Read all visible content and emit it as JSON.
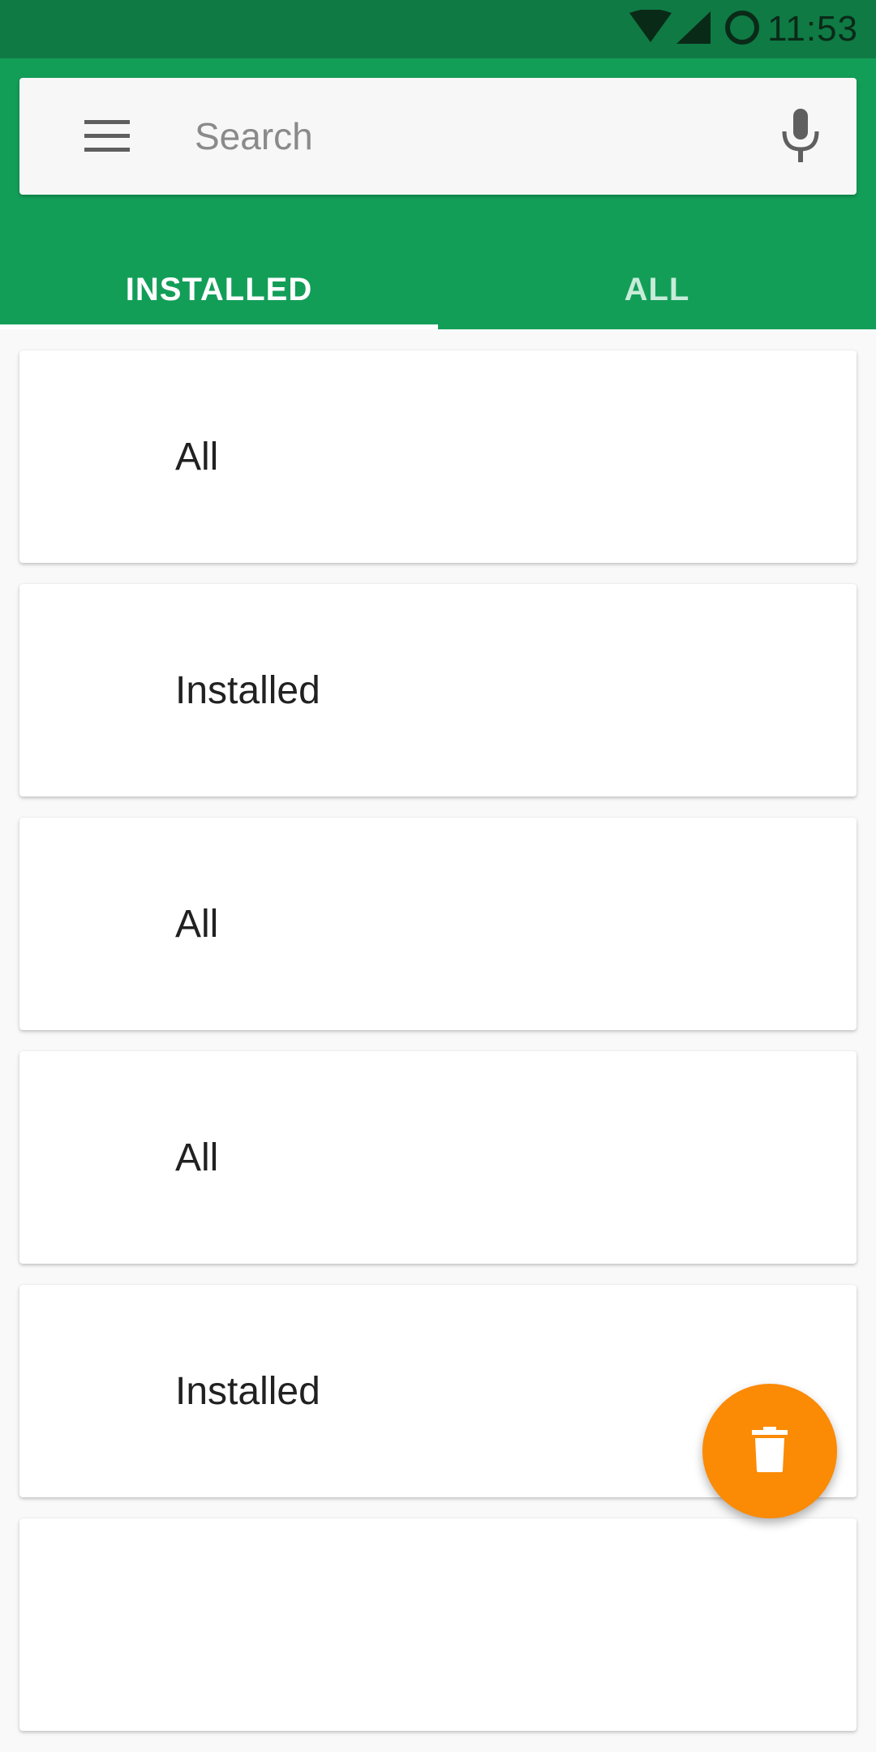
{
  "status_bar": {
    "time": "11:53",
    "icons": [
      "wifi-icon",
      "cell-signal-icon",
      "battery-ring-icon"
    ]
  },
  "search": {
    "placeholder": "Search",
    "menu_icon": "menu-icon",
    "mic_icon": "microphone-icon"
  },
  "tabs": [
    {
      "label": "INSTALLED",
      "selected": true
    },
    {
      "label": "ALL",
      "selected": false
    }
  ],
  "list": {
    "items": [
      {
        "label": "All"
      },
      {
        "label": "Installed"
      },
      {
        "label": "All"
      },
      {
        "label": "All"
      },
      {
        "label": "Installed"
      }
    ]
  },
  "fab": {
    "icon": "trash-icon"
  },
  "colors": {
    "status_bar": "#0f7a44",
    "app_bar": "#139e58",
    "fab": "#fb8a05",
    "background": "#f9f9f9"
  }
}
